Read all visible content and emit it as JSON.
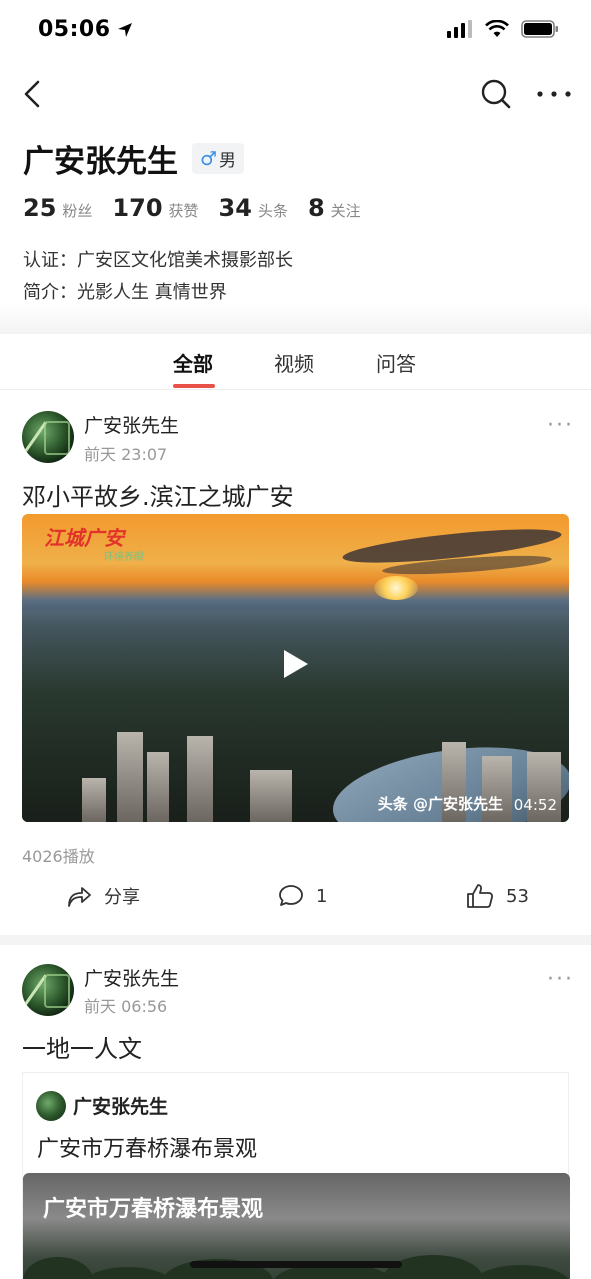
{
  "status_bar": {
    "time": "05:06"
  },
  "profile": {
    "name": "广安张先生",
    "gender": "男",
    "stats": [
      {
        "num": "25",
        "label": "粉丝"
      },
      {
        "num": "170",
        "label": "获赞"
      },
      {
        "num": "34",
        "label": "头条"
      },
      {
        "num": "8",
        "label": "关注"
      }
    ],
    "certification": "认证：广安区文化馆美术摄影部长",
    "intro": "简介：光影人生 真情世界"
  },
  "tabs": [
    {
      "label": "全部",
      "active": true
    },
    {
      "label": "视频",
      "active": false
    },
    {
      "label": "问答",
      "active": false
    }
  ],
  "posts": [
    {
      "author": "广安张先生",
      "time": "前天 23:07",
      "title": "邓小平故乡.滨江之城广安",
      "video": {
        "logo": "江城广安",
        "logo_sub": "环境养眼",
        "watermark": "头条 @广安张先生",
        "duration": "04:52"
      },
      "plays": "4026播放",
      "actions": {
        "share": "分享",
        "comments": "1",
        "likes": "53"
      }
    },
    {
      "author": "广安张先生",
      "time": "前天 06:56",
      "title": "一地一人文",
      "repost": {
        "author": "广安张先生",
        "title": "广安市万春桥瀑布景观",
        "image_title": "广安市万春桥瀑布景观"
      }
    }
  ],
  "colors": {
    "accent": "#e8524a",
    "text": "#222222",
    "muted": "#999999"
  }
}
